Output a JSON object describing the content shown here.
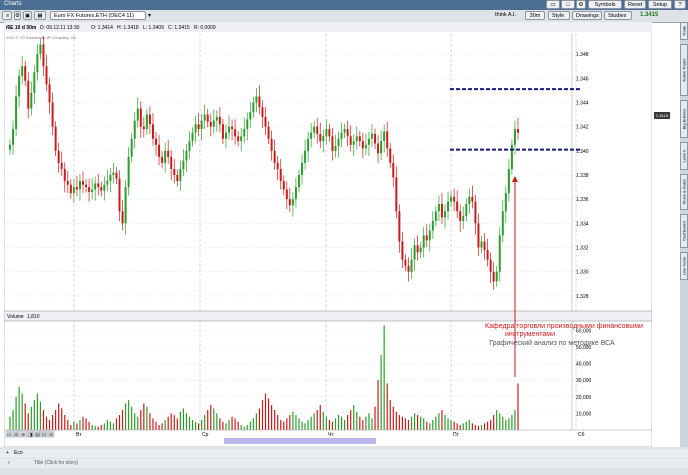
{
  "window": {
    "title": "Charts"
  },
  "toolbar": {
    "symbol": "Euro FX Futures,ETH (DEC4 11)",
    "think_ai": "think A.I.",
    "timeframe": "30m",
    "style": "Style",
    "drawings": "Drawings",
    "studies": "Studies",
    "last_price": "1.3415",
    "buttons": {
      "symbols": "Symbols",
      "reset": "Reset",
      "setup": "Setup"
    }
  },
  "chart": {
    "header": "/6E 10 d 30m",
    "date": "D: 09.12.11 13:30",
    "open": "O: 1.3414",
    "high": "H: 1.3418",
    "low": "L: 1.3409",
    "close": "C: 1.3415",
    "change": "R: 0.0009",
    "copyright": "2011 © TD Ameritrade IP Company, Inc.",
    "volume_label": "Volume",
    "volume_value": "1,810",
    "annotation": {
      "line1": "Кафедра торговли производными финансовыми",
      "line2": "инструментами",
      "line3": "Графический анализ по методике ВСА"
    }
  },
  "sidetabs": [
    "Trade",
    "Active Trader",
    "Big Buttons",
    "Level II",
    "Times & Sales",
    "Dashboard",
    "Live News"
  ],
  "status": {
    "row1": "Eco",
    "row2": "Title (Click for story)"
  },
  "colors": {
    "up": "#2a9d2a",
    "down": "#cc1a1a",
    "annotation": "#cc1a1a",
    "dashed": "#1a1a80"
  },
  "chart_data": {
    "type": "candlestick",
    "title": "",
    "x_labels": [
      "Вт",
      "Ср",
      "Чт",
      "Пт",
      "Сб"
    ],
    "y_ticks": [
      1.328,
      1.33,
      1.332,
      1.334,
      1.336,
      1.338,
      1.34,
      1.342,
      1.344,
      1.346,
      1.348
    ],
    "ylim": [
      1.327,
      1.349
    ],
    "volume_ticks": [
      "10,000",
      "20,000",
      "30,000",
      "40,000",
      "50,000",
      "60,000"
    ],
    "volume_ylim": [
      0,
      65000
    ],
    "resistance_levels": [
      1.3451,
      1.3401
    ],
    "last_price": 1.3415,
    "closes": [
      1.3405,
      1.3418,
      1.3445,
      1.3462,
      1.347,
      1.3458,
      1.3435,
      1.3448,
      1.3465,
      1.348,
      1.3488,
      1.347,
      1.3455,
      1.344,
      1.342,
      1.34,
      1.339,
      1.3385,
      1.3375,
      1.3372,
      1.3365,
      1.337,
      1.3368,
      1.3375,
      1.3372,
      1.337,
      1.3366,
      1.3368,
      1.3373,
      1.337,
      1.3367,
      1.3372,
      1.3375,
      1.338,
      1.3382,
      1.3377,
      1.335,
      1.334,
      1.337,
      1.3395,
      1.341,
      1.3425,
      1.3435,
      1.342,
      1.3418,
      1.343,
      1.3422,
      1.341,
      1.3405,
      1.3395,
      1.339,
      1.34,
      1.3395,
      1.3385,
      1.338,
      1.3375,
      1.3385,
      1.3392,
      1.34,
      1.3408,
      1.3415,
      1.3422,
      1.3418,
      1.3425,
      1.343,
      1.3424,
      1.342,
      1.3425,
      1.3428,
      1.3422,
      1.341,
      1.3415,
      1.342,
      1.3418,
      1.3412,
      1.3408,
      1.3412,
      1.3418,
      1.3426,
      1.3432,
      1.344,
      1.3445,
      1.3436,
      1.3428,
      1.342,
      1.341,
      1.34,
      1.339,
      1.3385,
      1.3375,
      1.3368,
      1.336,
      1.3355,
      1.336,
      1.337,
      1.338,
      1.339,
      1.34,
      1.341,
      1.3415,
      1.342,
      1.3414,
      1.3408,
      1.3412,
      1.3418,
      1.3412,
      1.34,
      1.3404,
      1.341,
      1.3415,
      1.3418,
      1.3412,
      1.3405,
      1.3408,
      1.3412,
      1.3408,
      1.3402,
      1.3405,
      1.341,
      1.3414,
      1.3406,
      1.3398,
      1.3408,
      1.3416,
      1.3402,
      1.339,
      1.3378,
      1.335,
      1.3325,
      1.331,
      1.3305,
      1.33,
      1.331,
      1.3322,
      1.3316,
      1.332,
      1.333,
      1.3326,
      1.3334,
      1.3342,
      1.335,
      1.3356,
      1.3345,
      1.335,
      1.3358,
      1.3362,
      1.3358,
      1.335,
      1.3342,
      1.3346,
      1.3356,
      1.3362,
      1.3358,
      1.334,
      1.332,
      1.3325,
      1.3318,
      1.331,
      1.33,
      1.3292,
      1.33,
      1.333,
      1.335,
      1.3365,
      1.3385,
      1.3405,
      1.3418,
      1.3415
    ],
    "volumes": [
      8000,
      12000,
      20000,
      26000,
      22000,
      16000,
      10000,
      14000,
      18000,
      22000,
      17000,
      12000,
      8000,
      6000,
      9000,
      12000,
      16000,
      13000,
      9000,
      6000,
      3000,
      5000,
      4000,
      6000,
      8000,
      7000,
      5000,
      3000,
      2500,
      2000,
      3000,
      4000,
      6000,
      5000,
      4000,
      7000,
      9000,
      12000,
      16000,
      18000,
      14000,
      10000,
      8000,
      12000,
      16000,
      14000,
      10000,
      7000,
      5000,
      3000,
      4000,
      6000,
      8000,
      10000,
      9000,
      7000,
      11000,
      13000,
      10000,
      8000,
      6000,
      5000,
      4000,
      6000,
      9000,
      12000,
      15000,
      13000,
      10000,
      7000,
      5000,
      4000,
      6000,
      8000,
      7000,
      5000,
      3000,
      2000,
      3000,
      5000,
      7000,
      10000,
      13000,
      18000,
      22000,
      19000,
      15000,
      12000,
      9000,
      6000,
      5000,
      7000,
      9000,
      11000,
      9000,
      7000,
      5000,
      4000,
      6000,
      8000,
      10000,
      12000,
      15000,
      11000,
      8000,
      6000,
      5000,
      7000,
      9000,
      8000,
      6000,
      9000,
      12000,
      15000,
      11000,
      8000,
      6000,
      8000,
      10000,
      7000,
      14000,
      30000,
      45000,
      63000,
      28000,
      18000,
      14000,
      11000,
      9000,
      8000,
      7000,
      6000,
      8000,
      10000,
      9000,
      8000,
      7000,
      5000,
      4000,
      6000,
      8000,
      10000,
      12000,
      9000,
      7000,
      6000,
      5000,
      4000,
      3000,
      4000,
      5000,
      6000,
      4000,
      3000,
      2500,
      3000,
      4000,
      5000,
      6000,
      9000,
      12000,
      10000,
      8000,
      6000,
      7000,
      9000,
      12000,
      28000
    ]
  }
}
